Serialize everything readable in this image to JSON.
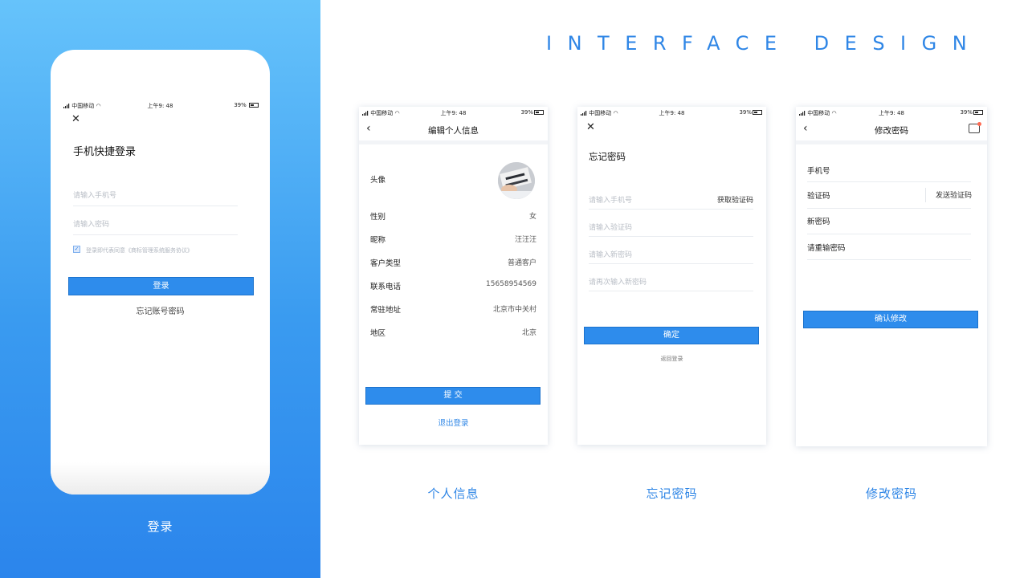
{
  "header": {
    "design_title": "INTERFACE DESIGN"
  },
  "status_bar": {
    "carrier": "中国移动",
    "time": "上午9: 48",
    "battery": "39%"
  },
  "login": {
    "title": "手机快捷登录",
    "phone_placeholder": "请输入手机号",
    "password_placeholder": "请输入密码",
    "agreement": "登录即代表同意《商标管理系统服务协议》",
    "submit_label": "登录",
    "forgot_link": "忘记账号密码",
    "caption": "登录"
  },
  "profile": {
    "nav_title": "编辑个人信息",
    "avatar_label": "头像",
    "fields": [
      {
        "label": "性别",
        "value": "女"
      },
      {
        "label": "昵称",
        "value": "汪汪汪"
      },
      {
        "label": "客户类型",
        "value": "普通客户"
      },
      {
        "label": "联系电话",
        "value": "15658954569"
      },
      {
        "label": "常驻地址",
        "value": "北京市中关村"
      },
      {
        "label": "地区",
        "value": "北京"
      }
    ],
    "submit_label": "提  交",
    "logout_link": "退出登录",
    "caption": "个人信息"
  },
  "forgot": {
    "title": "忘记密码",
    "phone_placeholder": "请输入手机号",
    "get_code_label": "获取验证码",
    "code_placeholder": "请输入验证码",
    "new_password_placeholder": "请输入新密码",
    "repeat_password_placeholder": "请再次输入新密码",
    "confirm_label": "确定",
    "back_to_login": "返回登录",
    "caption": "忘记密码"
  },
  "change_password": {
    "nav_title": "修改密码",
    "phone_label": "手机号",
    "code_label": "验证码",
    "send_code_label": "发送验证码",
    "new_password_label": "新密码",
    "repeat_password_label": "请重输密码",
    "confirm_label": "确认修改",
    "caption": "修改密码"
  },
  "colors": {
    "accent": "#2e8cec",
    "gradient_top": "#66c3fb",
    "gradient_bottom": "#2b85ec"
  },
  "icons": [
    "close-icon",
    "back-chevron-icon",
    "checkbox-checked-icon",
    "signal-icon",
    "wifi-icon",
    "battery-icon",
    "message-icon",
    "avatar-photo"
  ]
}
